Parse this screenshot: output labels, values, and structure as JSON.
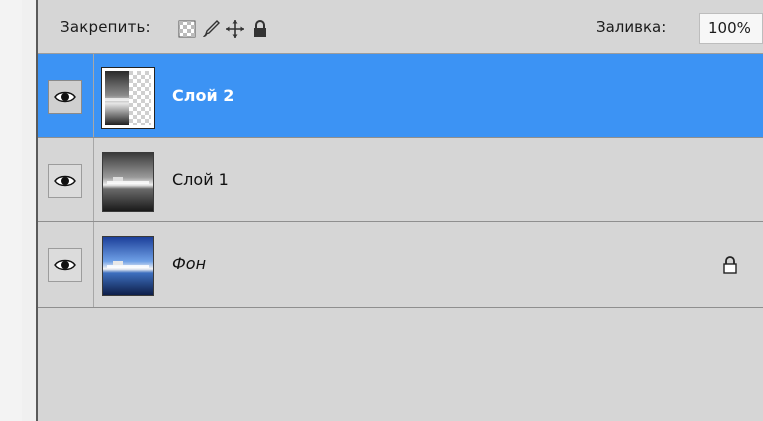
{
  "toolbar": {
    "lock_label": "Закрепить:",
    "lock_icons": [
      "lock-transparency-icon",
      "lock-paint-icon",
      "lock-position-icon",
      "lock-all-icon"
    ],
    "fill_label": "Заливка:",
    "fill_value": "100%"
  },
  "layers": [
    {
      "name": "Слой 2",
      "visible": true,
      "selected": true,
      "locked": false,
      "icon": "eye-icon"
    },
    {
      "name": "Слой 1",
      "visible": true,
      "selected": false,
      "locked": false,
      "icon": "eye-icon"
    },
    {
      "name": "Фон",
      "visible": true,
      "selected": false,
      "locked": true,
      "icon": "eye-icon"
    }
  ],
  "colors": {
    "selection": "#3c93f4",
    "panel": "#d6d6d6"
  }
}
